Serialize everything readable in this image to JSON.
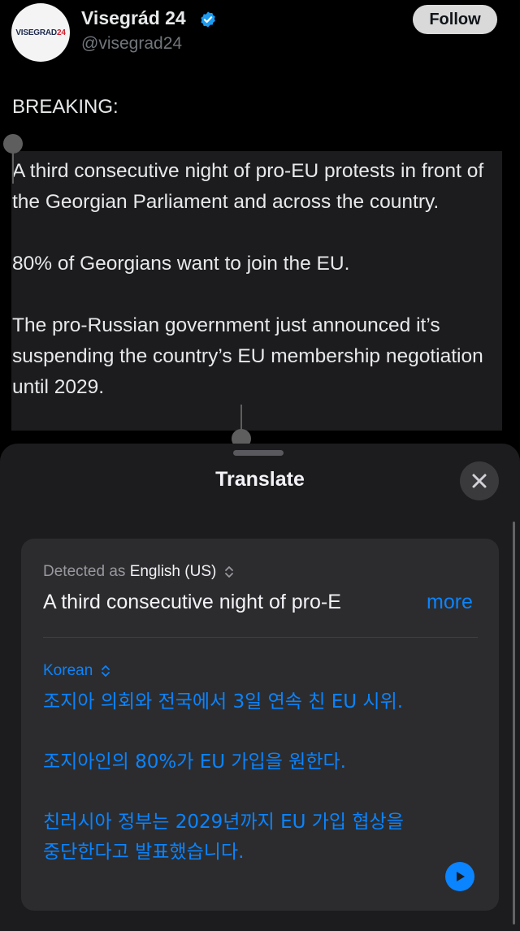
{
  "tweet": {
    "avatar_label_main": "VISEGRAD",
    "avatar_label_accent": "24",
    "author_name": "Visegrád 24",
    "handle": "@visegrad24",
    "follow_label": "Follow",
    "heading": "BREAKING:",
    "paragraphs": [
      "A third consecutive night of pro-EU protests in front of the Georgian Parliament and across the country.",
      "80% of Georgians want to join the EU.",
      "The pro-Russian government just announced it’s suspending the country’s EU membership negotiation until 2029."
    ]
  },
  "translate": {
    "title": "Translate",
    "detected_prefix": "Detected as",
    "detected_language": "English (US)",
    "source_preview": "A third consecutive night of pro-E",
    "more_label": "more",
    "target_language": "Korean",
    "translated_paragraphs": [
      "조지아 의회와 전국에서 3일 연속 친 EU 시위.",
      "조지아인의 80%가 EU 가입을 원한다.",
      "친러시아 정부는 2029년까지 EU 가입 협상을 중단한다고 발표했습니다."
    ]
  },
  "colors": {
    "accent_blue": "#0a84ff",
    "verified_blue": "#1d9bf0",
    "sheet_bg": "#1c1c1e",
    "card_bg": "#2c2c2e"
  },
  "icons": {
    "verified": "verified-badge-icon",
    "close": "close-icon",
    "language_switch": "chevron-up-down-icon",
    "play": "play-icon"
  }
}
